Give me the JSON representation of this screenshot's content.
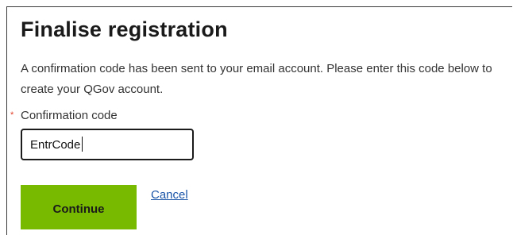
{
  "form": {
    "title": "Finalise registration",
    "intro": "A confirmation code has been sent to your email account. Please enter this code below to create your QGov account.",
    "required_marker": "*",
    "code_label": "Confirmation code",
    "code_value": "EntrCode",
    "continue_label": "Continue",
    "cancel_label": "Cancel"
  },
  "colors": {
    "continue_button": "#78ba00",
    "link": "#1a55a8",
    "required_marker": "#e0402a"
  }
}
